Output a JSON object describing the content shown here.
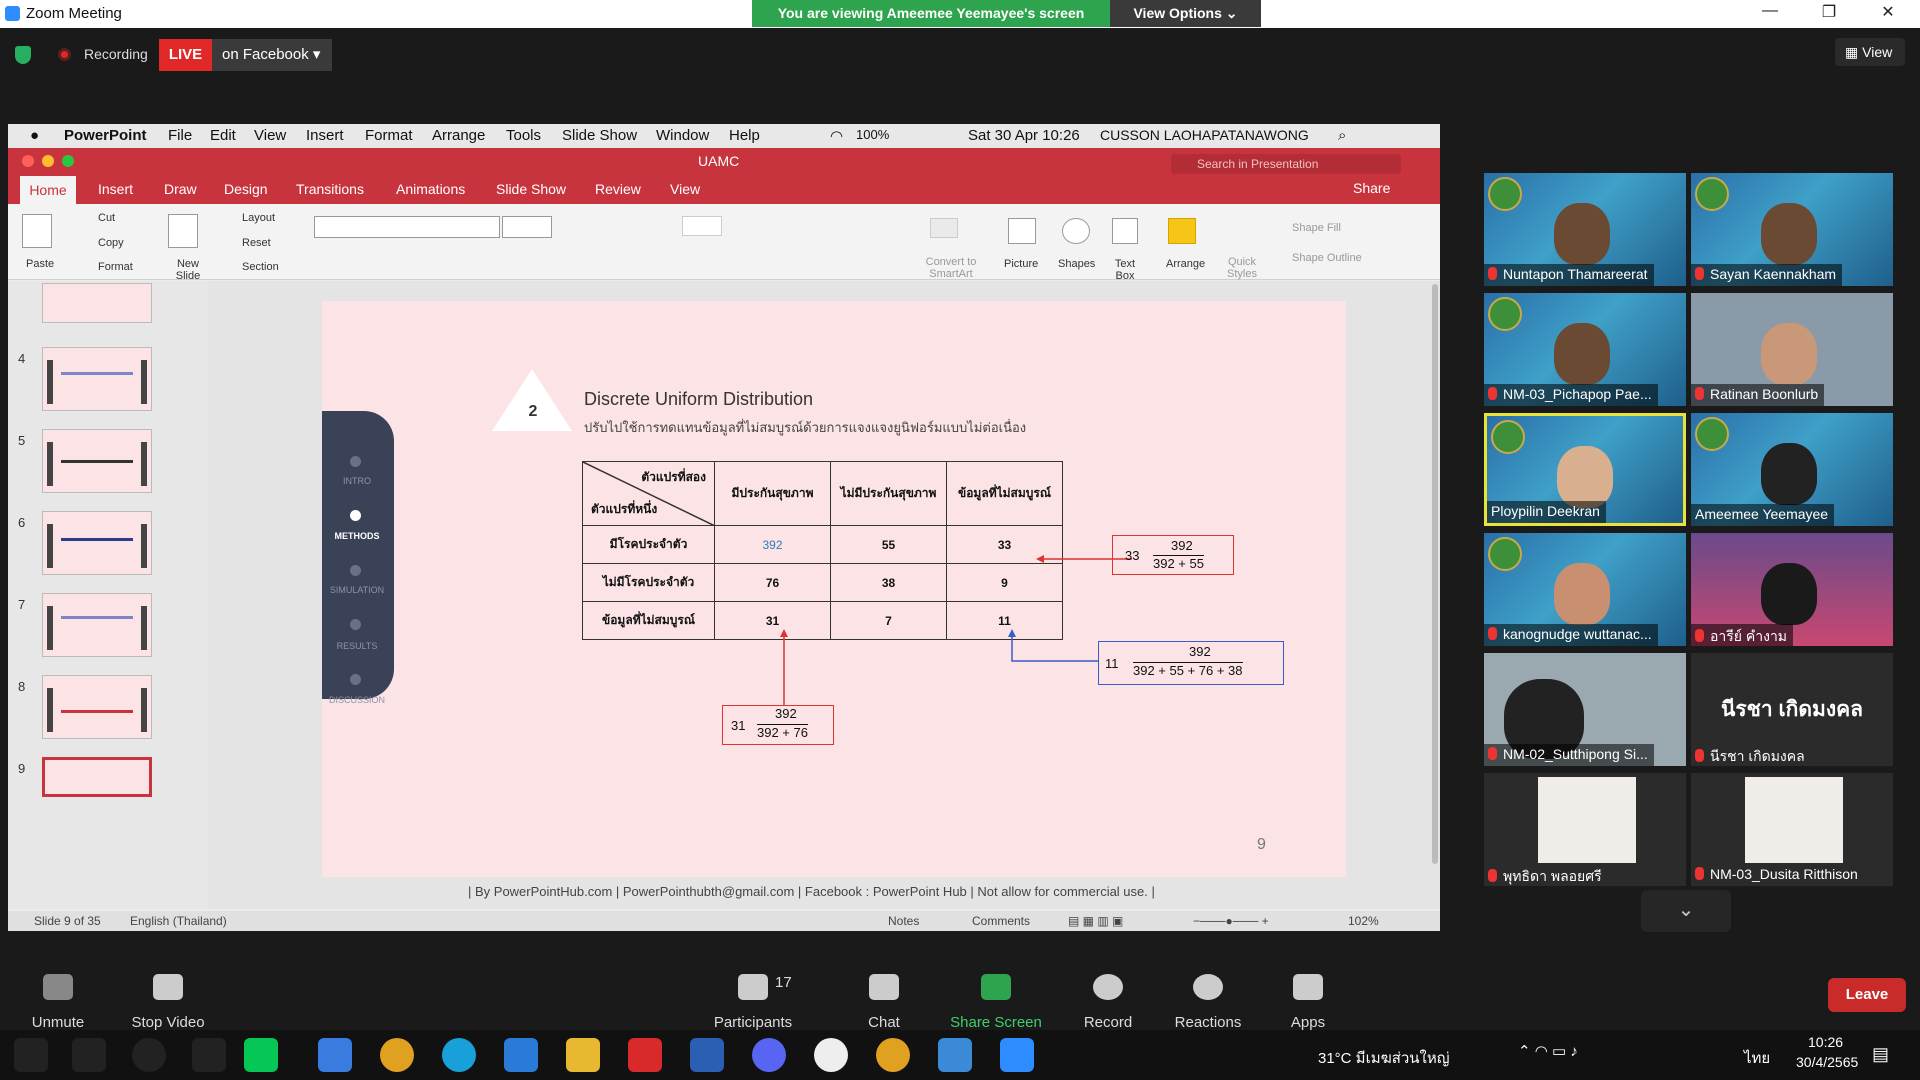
{
  "zoom": {
    "window_title": "Zoom Meeting",
    "viewing_banner": "You are viewing Ameemee Yeemayee's screen",
    "view_options": "View Options ⌄",
    "recording": "Recording",
    "live": "LIVE",
    "live_target": "on Facebook ▾",
    "view_button": "View",
    "window_controls": [
      "—",
      "❐",
      "✕"
    ]
  },
  "mac": {
    "apple": "",
    "menus": [
      "PowerPoint",
      "File",
      "Edit",
      "View",
      "Insert",
      "Format",
      "Arrange",
      "Tools",
      "Slide Show",
      "Window",
      "Help"
    ],
    "battery": "100%",
    "datetime": "Sat 30 Apr  10:26",
    "user": "CUSSON LAOHAPATANAWONG"
  },
  "ppt": {
    "doc_title": "UAMC",
    "search_placeholder": "Search in Presentation",
    "share": "Share",
    "tabs": [
      "Home",
      "Insert",
      "Draw",
      "Design",
      "Transitions",
      "Animations",
      "Slide Show",
      "Review",
      "View"
    ],
    "ribbon": {
      "paste": "Paste",
      "cut": "Cut",
      "copy": "Copy",
      "format": "Format",
      "new_slide": "New Slide",
      "layout": "Layout",
      "reset": "Reset",
      "section": "Section",
      "convert": "Convert to SmartArt",
      "picture": "Picture",
      "shapes": "Shapes",
      "text_box": "Text Box",
      "arrange": "Arrange",
      "quick_styles": "Quick Styles",
      "shape_fill": "Shape Fill",
      "shape_outline": "Shape Outline"
    },
    "thumb_numbers": [
      "4",
      "5",
      "6",
      "7",
      "8",
      "9"
    ],
    "status": {
      "slide": "Slide 9 of 35",
      "language": "English (Thailand)",
      "notes": "Notes",
      "comments": "Comments",
      "zoom": "102%"
    },
    "footer": "| By PowerPointHub.com | PowerPointhubth@gmail.com | Facebook : PowerPoint Hub | Not allow for commercial use. |"
  },
  "slide": {
    "number_badge": "2",
    "title": "Discrete Uniform Distribution",
    "subtitle": "ปรับไปใช้การทดแทนข้อมูลที่ไม่สมบูรณ์ด้วยการแจงแจงยูนิฟอร์มแบบไม่ต่อเนื่อง",
    "nav": [
      "INTRO",
      "METHODS",
      "SIMULATION",
      "RESULTS",
      "DISCUSSION"
    ],
    "table": {
      "corner_top": "ตัวแปรที่สอง",
      "corner_bottom": "ตัวแปรที่หนึ่ง",
      "col_headers": [
        "มีประกันสุขภาพ",
        "ไม่มีประกันสุขภาพ",
        "ข้อมูลที่ไม่สมบูรณ์"
      ],
      "rows": [
        {
          "label": "มีโรคประจำตัว",
          "cells": [
            "392",
            "55",
            "33"
          ]
        },
        {
          "label": "ไม่มีโรคประจำตัว",
          "cells": [
            "76",
            "38",
            "9"
          ]
        },
        {
          "label": "ข้อมูลที่ไม่สมบูรณ์",
          "cells": [
            "31",
            "7",
            "11"
          ]
        }
      ]
    },
    "formula_right": "33 ( 392 / 392 + 55 )",
    "formula_right_num": "392",
    "formula_right_den": "392 + 55",
    "formula_right_lead": "33",
    "formula_bottom_lead": "31",
    "formula_bottom_num": "392",
    "formula_bottom_den": "392 + 76",
    "formula_blue_lead": "11",
    "formula_blue_num": "392",
    "formula_blue_den": "392 + 55 + 76 + 38",
    "page_number": "9"
  },
  "participants": [
    {
      "name": "Nuntapon Thamareerat",
      "muted": true
    },
    {
      "name": "Sayan Kaennakham",
      "muted": true
    },
    {
      "name": "NM-03_Pichapop Pae...",
      "muted": true
    },
    {
      "name": "Ratinan Boonlurb",
      "muted": true
    },
    {
      "name": "Ploypilin Deekran",
      "muted": false
    },
    {
      "name": "Ameemee Yeemayee",
      "muted": false
    },
    {
      "name": "kanognudge wuttanac...",
      "muted": true
    },
    {
      "name": "อารีย์ คำงาม",
      "muted": true
    },
    {
      "name": "NM-02_Sutthipong Si...",
      "muted": true
    },
    {
      "name": "นีรชา เกิดมงคล",
      "muted": true,
      "big_name": "นีรชา เกิดมงคล"
    },
    {
      "name": "พุทธิดา พลอยศรี",
      "muted": true
    },
    {
      "name": "NM-03_Dusita Ritthison",
      "muted": true
    }
  ],
  "toolbar": {
    "unmute": "Unmute",
    "stop_video": "Stop Video",
    "participants": "Participants",
    "participants_count": "17",
    "chat": "Chat",
    "share_screen": "Share Screen",
    "record": "Record",
    "reactions": "Reactions",
    "apps": "Apps",
    "leave": "Leave"
  },
  "taskbar": {
    "weather": "31°C  มีเมฆส่วนใหญ่",
    "lang": "ไทย",
    "time": "10:26",
    "date": "30/4/2565"
  }
}
